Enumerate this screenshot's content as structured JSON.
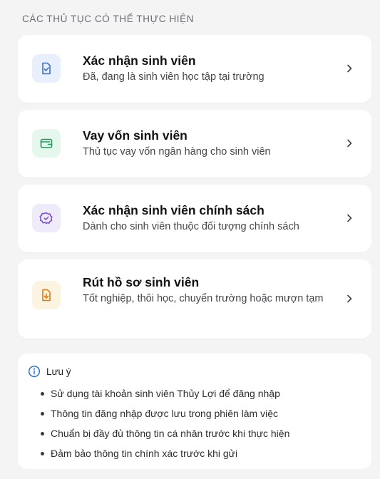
{
  "section_title": "CÁC THỦ TỤC CÓ THỂ THỰC HIỆN",
  "procedures": [
    {
      "title": "Xác nhận sinh viên",
      "description": "Đã, đang là sinh viên học tập tại trường",
      "icon": "document-check-icon",
      "icon_bg": "#e8f0fd",
      "icon_color": "#3b6fd8"
    },
    {
      "title": "Vay vốn sinh viên",
      "description": "Thủ tục vay vốn ngân hàng cho sinh viên",
      "icon": "wallet-icon",
      "icon_bg": "#e6f7ee",
      "icon_color": "#1f9a5c"
    },
    {
      "title": "Xác nhận sinh viên chính sách",
      "description": "Dành cho sinh viên thuộc đối tượng chính sách",
      "icon": "badge-check-icon",
      "icon_bg": "#efebfb",
      "icon_color": "#7a4fd6"
    },
    {
      "title": "Rút hồ sơ sinh viên",
      "description": "Tốt nghiệp, thôi học, chuyển trường hoặc mượn tạm",
      "icon": "document-download-icon",
      "icon_bg": "#fdf3e1",
      "icon_color": "#e07d10"
    }
  ],
  "note": {
    "title": "Lưu ý",
    "icon": "info-icon",
    "accent": "#2f6fe0",
    "items": [
      "Sử dụng tài khoản sinh viên Thủy Lợi để đăng nhập",
      "Thông tin đăng nhập được lưu trong phiên làm việc",
      "Chuẩn bị đầy đủ thông tin cá nhân trước khi thực hiện",
      "Đảm bảo thông tin chính xác trước khi gửi"
    ]
  }
}
